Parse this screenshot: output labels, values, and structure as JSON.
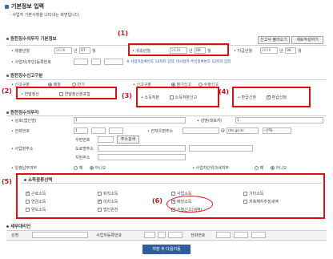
{
  "header": {
    "title": "기본정보 입력",
    "note": "- 사업자 기본사항을 나타내는 화면입니다."
  },
  "basic": {
    "section": "원천징수의무자 기본정보",
    "btn_load": "신고서 불러오기",
    "btn_new": "새로작성하기",
    "submit_year_label": "제출년월",
    "submit_year": "2016",
    "submit_month": "07",
    "unit_year": "년",
    "unit_month": "월",
    "belong_label": "귀속년월",
    "belong_year": "2016",
    "belong_month": "06",
    "pay_label": "지급년월",
    "pay_year": "2016",
    "pay_month": "06",
    "bizno_label": "사업자(주민)등록번호",
    "bizno_hint": "※ 법인사업자의 경우 사업자등록번호 10자리를 입력하며, 비사업자는 주민등록번호 13자리 입력",
    "bizno_hint_visible": "※ 사업자등록번호 10자리 입력, 비사업자 주민등록번호 13자리 입력"
  },
  "labels": {
    "l1": "(1)",
    "l2": "(2)",
    "l3": "(3)",
    "l4": "(4)",
    "l5": "(5)",
    "l6": "(6)"
  },
  "report": {
    "section": "원천징수신고구분",
    "type_label": "신고구분",
    "opt_monthly": "매월",
    "opt_half": "반기",
    "type2_label": "신고구분",
    "opt_regular": "정기신고",
    "opt_amend": "수정신고",
    "year_settle": "연말정산",
    "year_settle_cb": "연말정산분포함",
    "income_dispose": "소득처분",
    "income_dispose_cb": "소득처분신고",
    "refund": "환급신청",
    "refund_cb": "환급신청"
  },
  "owner": {
    "section": "원천징수의무자",
    "name_label": "상호(법인명)",
    "name_val": "1",
    "rep_label": "성명(대표자)",
    "rep_val": "1",
    "phone_label": "전화번호",
    "phone_val": "1",
    "email_label": "전자우편주소",
    "email_at": "@",
    "email_domain": "nts.go.kr",
    "email_select": "-선택-",
    "addr_label": "사업장주소",
    "zip_label": "우편번호",
    "zip_btn": "주소검색",
    "road_label": "도로명주소",
    "jibun_label": "지번주소",
    "batch_label": "일괄납부여부",
    "batch_yes": "예",
    "batch_no": "아니오",
    "unit_label": "사업자단위과세여부",
    "unit_yes": "예",
    "unit_no": "아니오"
  },
  "income": {
    "section": "소득종류선택",
    "items": [
      "근로소득",
      "퇴직소득",
      "사업소득",
      "기타소득",
      "연금소득",
      "이자소득",
      "배당소득",
      "저축해지추징세액",
      "양도소득",
      "법인원천",
      "수정신고(세액)"
    ]
  },
  "tax_agent": {
    "section": "세무대리인",
    "name_label": "성명",
    "bizno_label": "사업자등록번호",
    "phone_label": "전화번호"
  },
  "footer": {
    "save": "저장 후 다음이동"
  },
  "colors": {
    "accent": "#2f5f9a",
    "highlight": "#e01010"
  }
}
